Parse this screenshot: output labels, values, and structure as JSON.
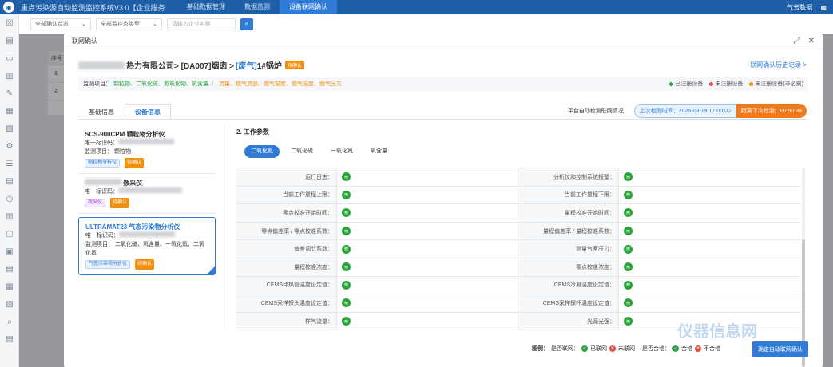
{
  "app": {
    "title": "重点污染源自动监测监控系统V3.0【企业服务端】",
    "nav": [
      "基础数据管理",
      "数据监测",
      "设备联网确认"
    ],
    "right_labels": [
      "气云数据"
    ]
  },
  "filters": {
    "status": "全部确认状态",
    "point_type": "全部监控点类型",
    "search_placeholder": "请输入企业名称"
  },
  "bg_table": {
    "header": "序号",
    "rows": [
      "1",
      "2"
    ]
  },
  "modal": {
    "title": "联网确认",
    "crumb_company": "热力有限公司",
    "crumb_point": " > [DA007]烟囱 > ",
    "crumb_type": "[废气]",
    "crumb_name": " 1#锅炉",
    "crumb_tag": "待确认",
    "history_link": "联网确认历史记录 >",
    "monitor_label": "监测项目：",
    "monitor_green": "颗粒物、二氧化硫、氮氧化物、氧含量",
    "monitor_sep": "|",
    "monitor_orange": "流量、烟气流速、烟气温度、烟气湿度、烟气压力",
    "legend_top": [
      "已注册设备",
      "未注册设备",
      "未注册设备(非必需)"
    ],
    "tabs": [
      "基础信息",
      "设备信息"
    ],
    "auto_label": "平台自动检测联网情况：",
    "last_check": "上次检测时间：2026-03-19 17:00:00",
    "next_check": "距离下次检测：00:50:38"
  },
  "devices": [
    {
      "name": "SCS-900CPM 颗粒物分析仪",
      "id_label": "唯一标识码：",
      "items": "监测项目： 颗粒物",
      "tag1": "颗粒物分析仪",
      "tag2": "待确认"
    },
    {
      "name": "数采仪",
      "id_label": "唯一标识码：",
      "tag1": "数采仪",
      "tag2": "待确认"
    },
    {
      "name": "ULTRAMAT23 气态污染物分析仪",
      "id_label": "唯一标识码：",
      "items": "监测项目： 二氧化硫、氧含量、一氧化氮、二氧化氮",
      "tag1": "气态污染物分析仪",
      "tag2": "待确认"
    }
  ],
  "section_title": "2. 工作参数",
  "param_tabs": [
    "二氧化氮",
    "二氧化硫",
    "一氧化氮",
    "氧含量"
  ],
  "params": [
    [
      "运行日志：",
      "分析仪和控制系统报警："
    ],
    [
      "当前工作量程上限：",
      "当前工作量程下限："
    ],
    [
      "零点校准开始时间：",
      "量程校准开始时间："
    ],
    [
      "零点偏差率 / 零点校准系数：",
      "量程偏差率 / 量程校准系数："
    ],
    [
      "偏差调节系数：",
      "测量气室压力："
    ],
    [
      "量程校准浓度：",
      "零点校准浓度："
    ],
    [
      "CEMS伴热管温度设定值：",
      "CEMS冷凝温度设定值："
    ],
    [
      "CEMS采样探头温度设定值：",
      "CEMS采样探杆温度设定值："
    ],
    [
      "样气流量：",
      "光源光强："
    ]
  ],
  "bottom": {
    "legend": "图例：",
    "online_label": "是否联网：",
    "online": "已联网",
    "offline": "未联网",
    "ok_label": "是否合格：",
    "ok": "合格",
    "notok": "不合格",
    "confirm": "确定自动联网确认"
  },
  "watermark": "仪器信息网",
  "colors": {
    "primary": "#2f7bd6",
    "green": "#2aa53c",
    "orange": "#f0900e",
    "red": "#e54b3c"
  }
}
